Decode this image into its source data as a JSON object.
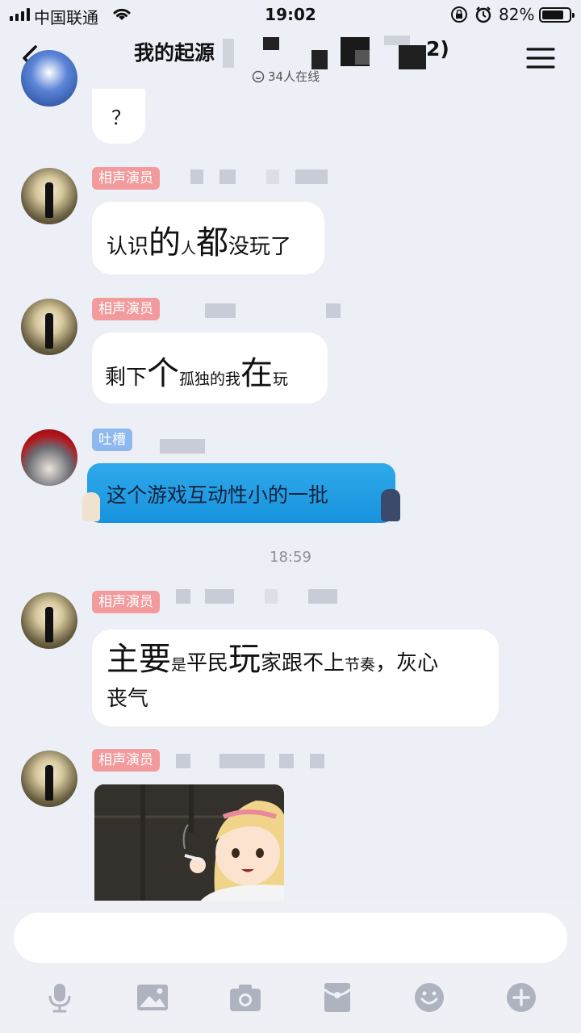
{
  "status_bar": {
    "carrier": "中国联通",
    "time": "19:02",
    "battery": "82%",
    "battery_level": 0.82
  },
  "header": {
    "title": "我的起源",
    "title_suffix": "2)",
    "online": "34人在线",
    "icons": [
      "back-arrow-icon",
      "menu-icon",
      "online-status-icon"
    ]
  },
  "messages": [
    {
      "role": "相声演员",
      "text": "？"
    },
    {
      "role": "相声演员",
      "segments": [
        "认识",
        "的",
        "人",
        "都",
        "没玩了"
      ]
    },
    {
      "role": "相声演员",
      "segments": [
        "剩下",
        "个",
        "孤独的我",
        "在",
        "玩"
      ]
    },
    {
      "role": "吐槽",
      "text": "这个游戏互动性小的一批"
    },
    {
      "role": "相声演员",
      "segments": [
        "主要",
        "是",
        "平民",
        "玩",
        "家跟不上",
        "节奏",
        "，灰心",
        "丧气"
      ]
    },
    {
      "role": "相声演员",
      "type": "image"
    }
  ],
  "time_divider": "18:59",
  "input": {
    "value": "",
    "placeholder": ""
  },
  "toolbar": [
    "microphone-icon",
    "image-icon",
    "camera-icon",
    "red-packet-icon",
    "emoji-icon",
    "plus-icon"
  ],
  "colors": {
    "role_tag": "#f39a9c",
    "role_tag_alt": "#8db8f0",
    "themed_bubble": "#1793de"
  }
}
